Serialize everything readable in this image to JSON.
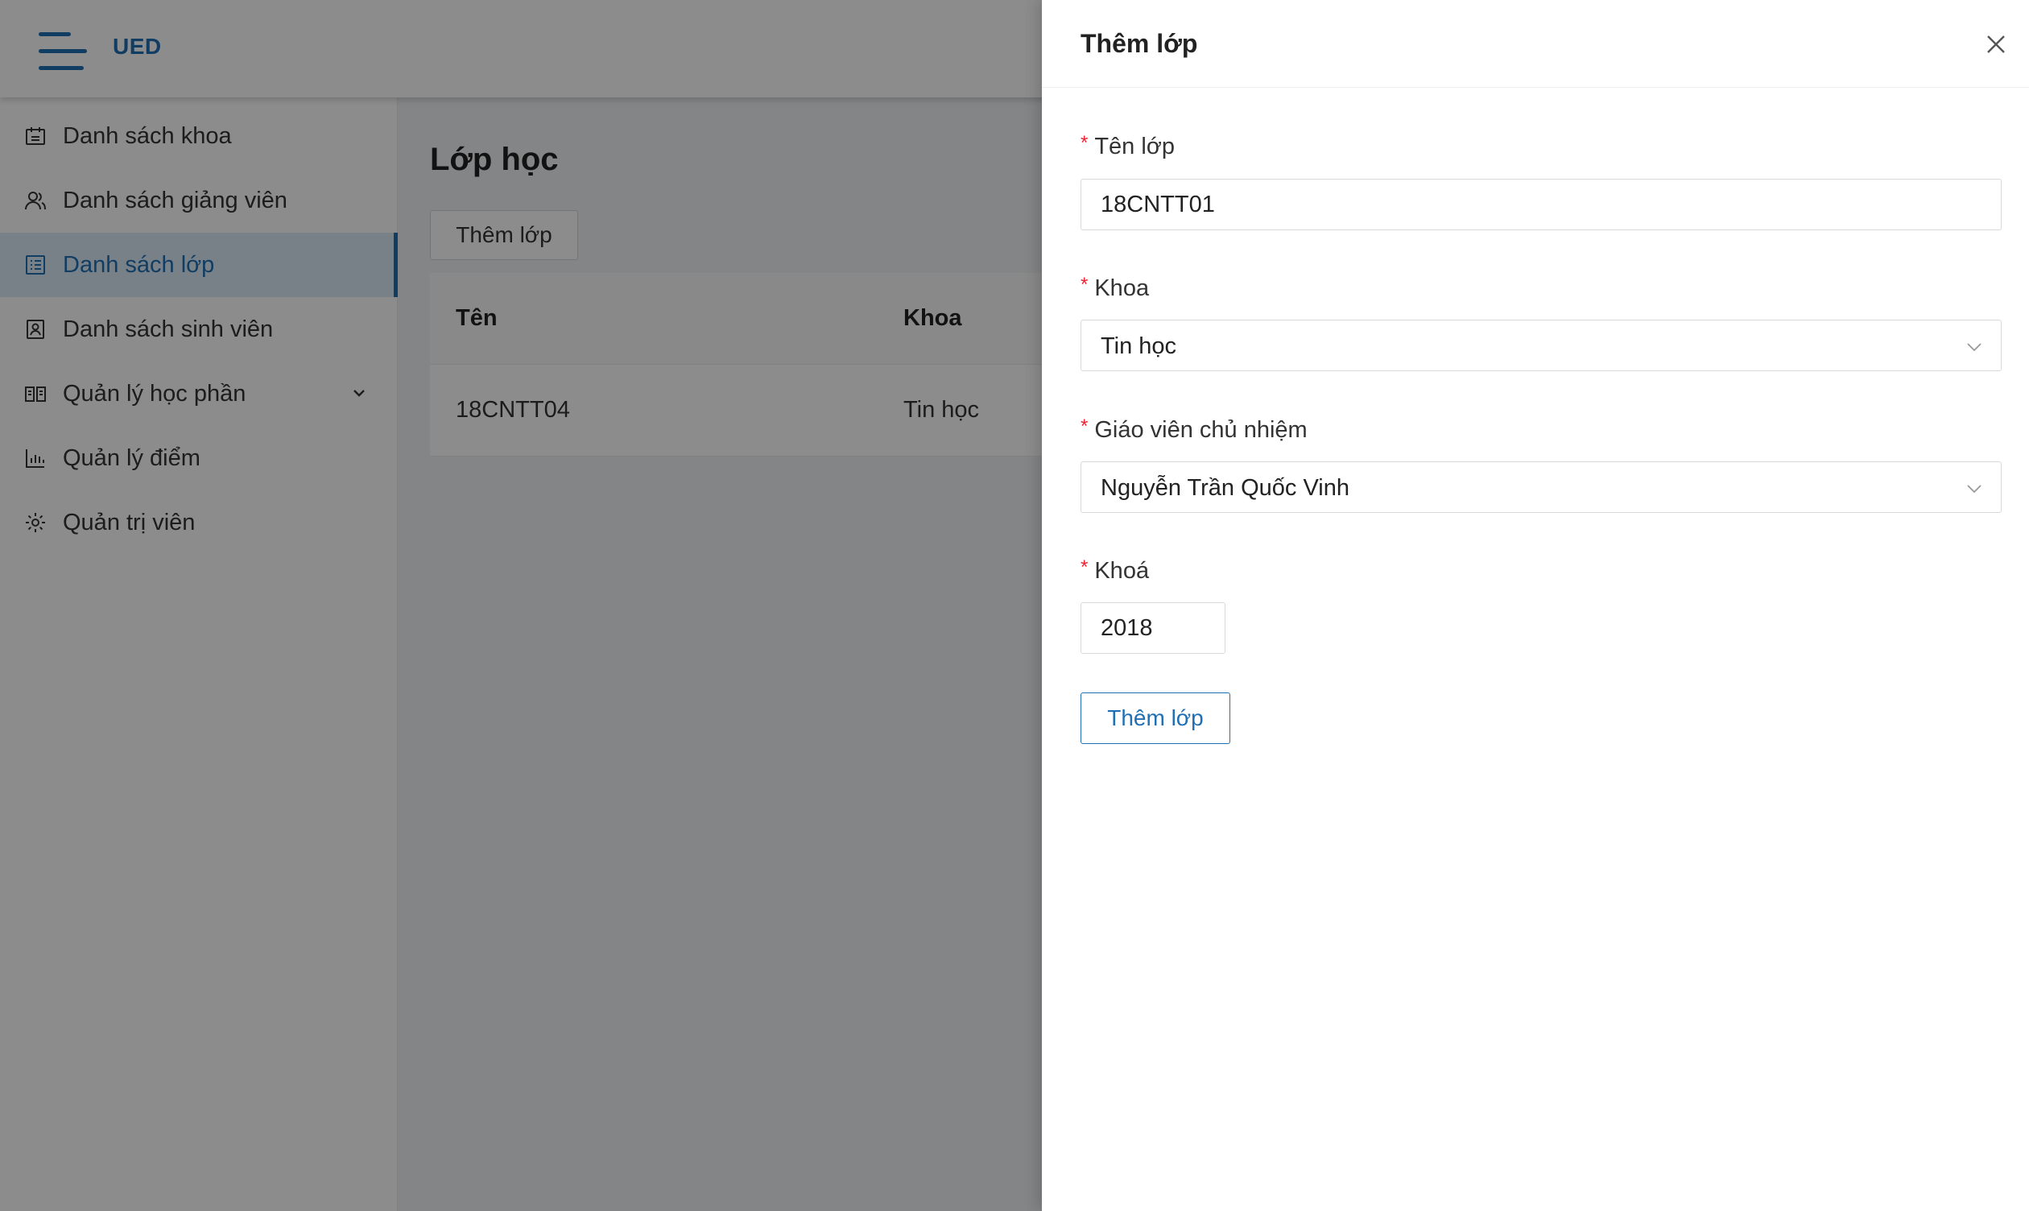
{
  "header": {
    "brand": "UED"
  },
  "sidebar": {
    "items": [
      {
        "label": "Danh sách khoa",
        "icon": "building-icon"
      },
      {
        "label": "Danh sách giảng viên",
        "icon": "users-icon"
      },
      {
        "label": "Danh sách lớp",
        "icon": "list-icon",
        "active": true
      },
      {
        "label": "Danh sách sinh viên",
        "icon": "profile-icon"
      },
      {
        "label": "Quản lý học phần",
        "icon": "book-icon",
        "expandable": true
      },
      {
        "label": "Quản lý điểm",
        "icon": "bar-chart-icon"
      },
      {
        "label": "Quản trị viên",
        "icon": "gear-icon"
      }
    ]
  },
  "main": {
    "title": "Lớp học",
    "add_button": "Thêm lớp",
    "table": {
      "columns": [
        "Tên",
        "Khoa"
      ],
      "rows": [
        [
          "18CNTT04",
          "Tin học"
        ]
      ]
    }
  },
  "drawer": {
    "title": "Thêm lớp",
    "fields": {
      "ten_lop": {
        "label": "Tên lớp",
        "value": "18CNTT01",
        "required": true
      },
      "khoa_dept": {
        "label": "Khoa",
        "value": "Tin học",
        "required": true
      },
      "gvcn": {
        "label": "Giáo viên chủ nhiệm",
        "value": "Nguyễn Trần Quốc Vinh",
        "required": true
      },
      "khoa_year": {
        "label": "Khoá",
        "value": "2018",
        "required": true
      }
    },
    "submit_label": "Thêm lớp",
    "required_marker": "*"
  },
  "colors": {
    "accent": "#1f6fb5",
    "required": "#f5222d",
    "overlay": "rgba(0,0,0,0.45)"
  }
}
